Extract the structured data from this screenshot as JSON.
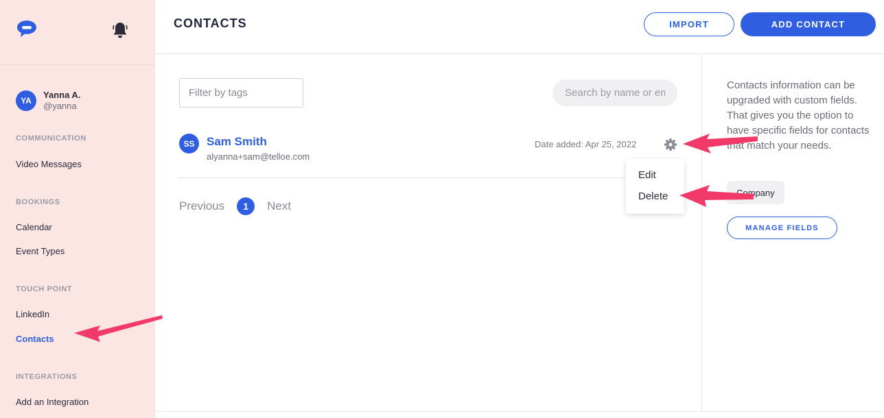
{
  "colors": {
    "accent": "#2f5fe0",
    "sidebar_bg": "#fbe6e3",
    "annotation": "#f23a6a"
  },
  "sidebar": {
    "logo_icon": "chat-bubble-icon",
    "bell_icon": "bell-icon",
    "user": {
      "initials": "YA",
      "name": "Yanna A.",
      "handle": "@yanna"
    },
    "sections": [
      {
        "title": "COMMUNICATION",
        "items": [
          {
            "label": "Video Messages"
          }
        ]
      },
      {
        "title": "BOOKINGS",
        "items": [
          {
            "label": "Calendar"
          },
          {
            "label": "Event Types"
          }
        ]
      },
      {
        "title": "TOUCH POINT",
        "items": [
          {
            "label": "LinkedIn"
          },
          {
            "label": "Contacts",
            "active": true
          }
        ]
      },
      {
        "title": "INTEGRATIONS",
        "items": [
          {
            "label": "Add an Integration"
          }
        ]
      }
    ]
  },
  "header": {
    "title": "CONTACTS",
    "import_label": "IMPORT",
    "add_contact_label": "ADD CONTACT"
  },
  "main": {
    "filter_placeholder": "Filter by tags",
    "search_placeholder": "Search by name or email",
    "contacts": [
      {
        "initials": "SS",
        "name": "Sam Smith",
        "email": "alyanna+sam@telloe.com",
        "date_added": "Date added: Apr 25, 2022"
      }
    ],
    "dropdown": {
      "edit_label": "Edit",
      "delete_label": "Delete"
    },
    "pagination": {
      "previous_label": "Previous",
      "current_page": "1",
      "next_label": "Next"
    }
  },
  "right_panel": {
    "description": "Contacts information can be upgraded with custom fields. That gives you the option to have specific fields for contacts that match your needs.",
    "field_chip": "Company",
    "manage_fields_label": "MANAGE FIELDS"
  }
}
